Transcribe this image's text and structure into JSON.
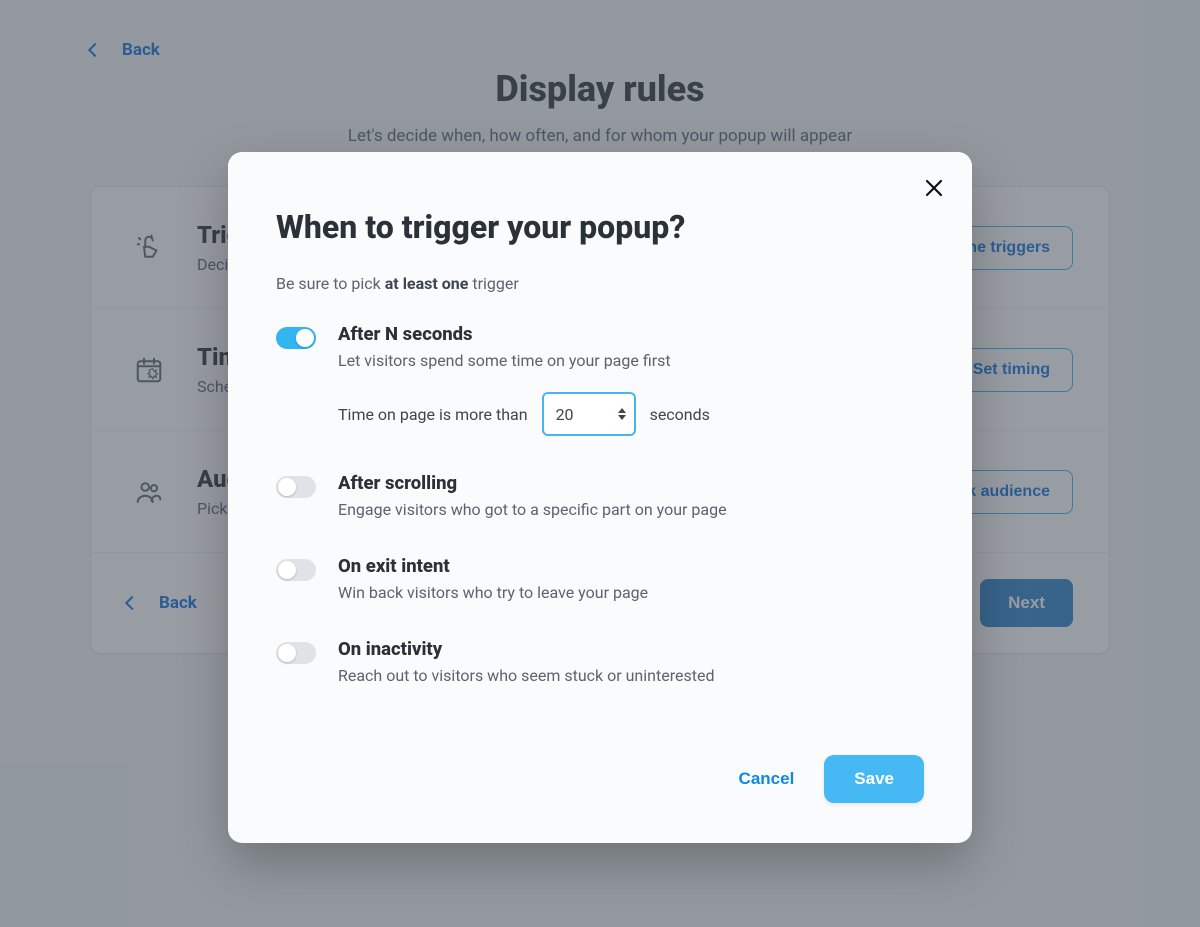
{
  "page": {
    "back": "Back",
    "title": "Display rules",
    "subtitle": "Let's decide when, how often, and for whom your popup will appear",
    "rows": [
      {
        "title": "Triggers",
        "desc": "Decide when your popup will appear",
        "action": "Define triggers"
      },
      {
        "title": "Timing",
        "desc": "Schedule your popup campaign",
        "action": "Set timing"
      },
      {
        "title": "Audience",
        "desc": "Pick who will see your popup",
        "action": "Pick audience"
      }
    ],
    "footer_back": "Back",
    "next": "Next"
  },
  "modal": {
    "title": "When to trigger your popup?",
    "sub_pre": "Be sure to pick ",
    "sub_strong": "at least one",
    "sub_post": " trigger",
    "options": {
      "after_seconds": {
        "title": "After N seconds",
        "desc": "Let visitors spend some time on your page first",
        "row_pre": "Time on page is more than",
        "value": "20",
        "row_post": "seconds",
        "enabled": true
      },
      "after_scrolling": {
        "title": "After scrolling",
        "desc": "Engage visitors who got to a specific part on your page",
        "enabled": false
      },
      "exit_intent": {
        "title": "On exit intent",
        "desc": "Win back visitors who try to leave your page",
        "enabled": false
      },
      "inactivity": {
        "title": "On inactivity",
        "desc": "Reach out to visitors who seem stuck or uninterested",
        "enabled": false
      }
    },
    "cancel": "Cancel",
    "save": "Save"
  }
}
